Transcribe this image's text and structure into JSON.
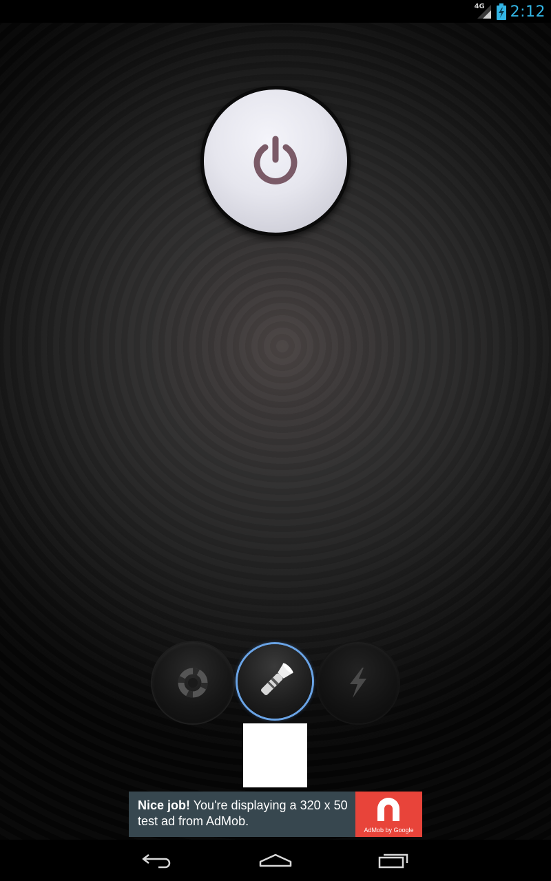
{
  "status_bar": {
    "network_label": "4G",
    "time": "2:12",
    "clock_color": "#33b5e5"
  },
  "power_button": {
    "icon": "power-icon",
    "icon_color": "#7a5a67"
  },
  "modes": {
    "items": [
      {
        "name": "lifebuoy-mode",
        "icon": "lifebuoy-icon",
        "selected": false
      },
      {
        "name": "flashlight-mode",
        "icon": "flashlight-icon",
        "selected": true
      },
      {
        "name": "strobe-mode",
        "icon": "lightning-icon",
        "selected": false
      }
    ],
    "selected_ring_color": "#6aa4e6"
  },
  "ad": {
    "headline": "Nice job!",
    "body": " You're displaying a 320 x 50 test ad from AdMob.",
    "logo_caption": "AdMob by Google",
    "background": "#37474f",
    "logo_background": "#e8443a"
  },
  "nav_bar": {
    "items": [
      "back-icon",
      "home-icon",
      "recent-apps-icon"
    ]
  }
}
